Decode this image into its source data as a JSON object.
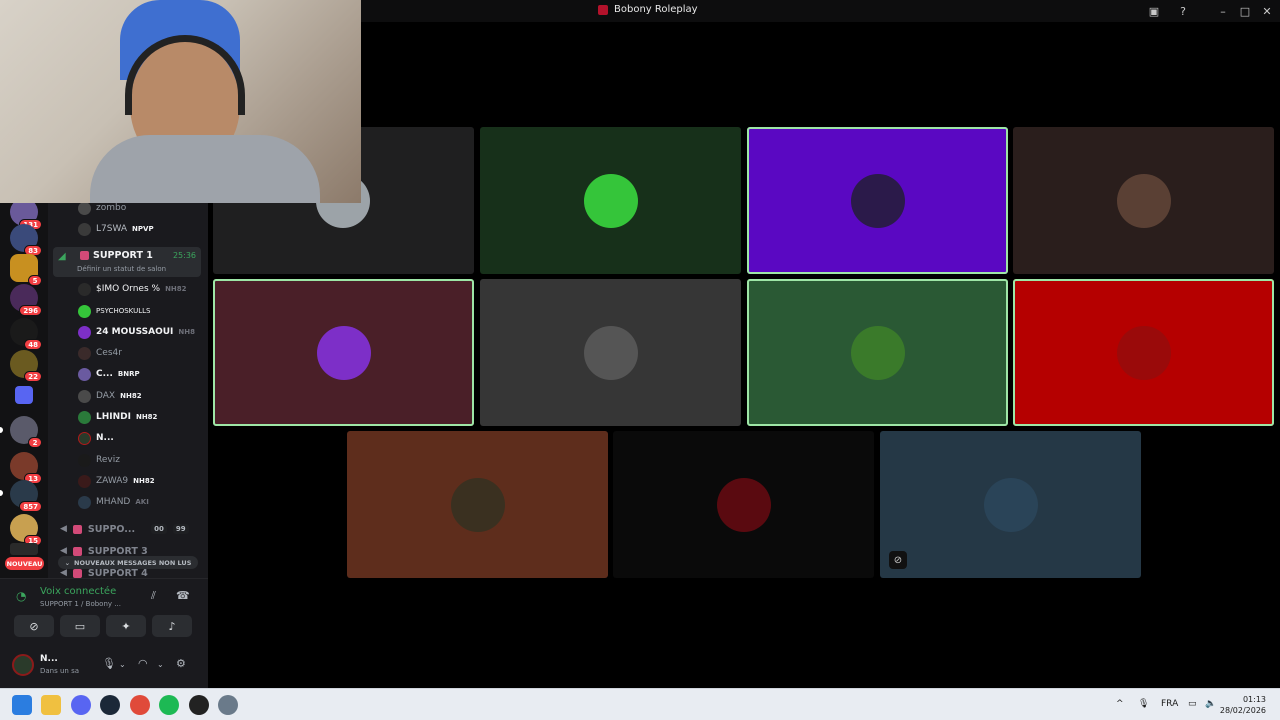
{
  "window": {
    "title": "Bobony Roleplay"
  },
  "rail": {
    "badges": [
      "131",
      "83",
      "5",
      "296",
      "48",
      "22",
      "2",
      "13",
      "857",
      "15"
    ],
    "new_label": "NOUVEAU"
  },
  "channels": {
    "members_top": [
      {
        "name": "zombo",
        "tag": ""
      },
      {
        "name": "L7SWA",
        "tag": "NPVP"
      }
    ],
    "active_channel": {
      "name": "SUPPORT 1",
      "time": "25:36",
      "status_hint": "Définir un statut de salon"
    },
    "members": [
      {
        "name": "$IMO Ornes %",
        "tag": "NH82"
      },
      {
        "name": "PSYCHOSKULLS",
        "tag": ""
      },
      {
        "name": "24 MOUSSAOUI",
        "tag": "NH8"
      },
      {
        "name": "Ces4r",
        "tag": ""
      },
      {
        "name": "C...",
        "tag": "BNRP"
      },
      {
        "name": "DAX",
        "tag": "NH82"
      },
      {
        "name": "LHINDI",
        "tag": "NH82"
      },
      {
        "name": "N...",
        "tag": ""
      },
      {
        "name": "Reviz",
        "tag": ""
      },
      {
        "name": "ZAWA9",
        "tag": "NH82"
      },
      {
        "name": "MHAND",
        "tag": "AKI"
      }
    ],
    "other_channels": [
      {
        "name": "SUPPO...",
        "count_a": "00",
        "count_b": "99"
      },
      {
        "name": "SUPPORT 3"
      },
      {
        "name": "SUPPORT 4"
      }
    ],
    "unread_label": "NOUVEAUX MESSAGES NON LUS"
  },
  "voice_panel": {
    "status": "Voix connectée",
    "location": "SUPPORT 1 / Bobony ...",
    "user_name": "N...",
    "user_status": "Dans un sa"
  },
  "tiles": [
    {
      "bg": "#1f1f20",
      "avatar": "#9ca3a8",
      "speaking": false
    },
    {
      "bg": "#17301a",
      "avatar": "#35c53a",
      "speaking": false
    },
    {
      "bg": "#5a08c2",
      "avatar": "#2b1a4a",
      "speaking": true
    },
    {
      "bg": "#2a1e1c",
      "avatar": "#5a4034",
      "speaking": false
    },
    {
      "bg": "#4a1f28",
      "avatar": "#7d2fc8",
      "speaking": true
    },
    {
      "bg": "#363636",
      "avatar": "#555555",
      "speaking": false
    },
    {
      "bg": "#2a5934",
      "avatar": "#3a7a2a",
      "speaking": true
    },
    {
      "bg": "#b50000",
      "avatar": "#9a0a0a",
      "speaking": true
    },
    {
      "bg": "#5e2d1c",
      "avatar": "#3a3020",
      "speaking": false
    },
    {
      "bg": "#0a0a0a",
      "avatar": "#5a0a10",
      "speaking": false
    },
    {
      "bg": "#253846",
      "avatar": "#2a4458",
      "speaking": false
    }
  ],
  "taskbar": {
    "language": "FRA",
    "time": "01:13",
    "date": "28/02/2026"
  }
}
